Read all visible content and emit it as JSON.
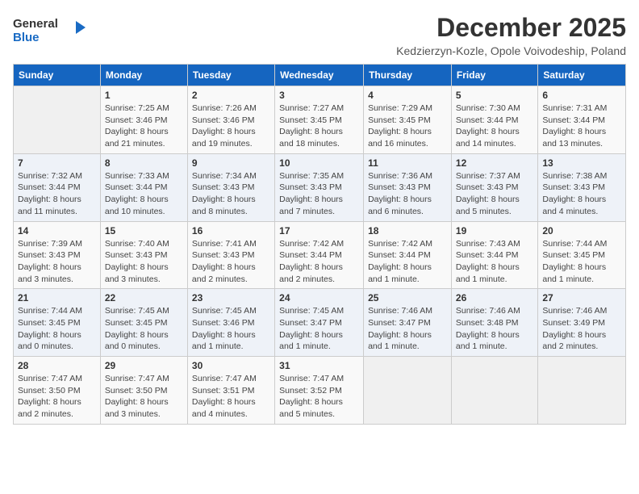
{
  "logo": {
    "line1": "General",
    "line2": "Blue"
  },
  "title": "December 2025",
  "location": "Kedzierzyn-Kozle, Opole Voivodeship, Poland",
  "days_header": [
    "Sunday",
    "Monday",
    "Tuesday",
    "Wednesday",
    "Thursday",
    "Friday",
    "Saturday"
  ],
  "weeks": [
    [
      {
        "day": "",
        "text": ""
      },
      {
        "day": "1",
        "text": "Sunrise: 7:25 AM\nSunset: 3:46 PM\nDaylight: 8 hours\nand 21 minutes."
      },
      {
        "day": "2",
        "text": "Sunrise: 7:26 AM\nSunset: 3:46 PM\nDaylight: 8 hours\nand 19 minutes."
      },
      {
        "day": "3",
        "text": "Sunrise: 7:27 AM\nSunset: 3:45 PM\nDaylight: 8 hours\nand 18 minutes."
      },
      {
        "day": "4",
        "text": "Sunrise: 7:29 AM\nSunset: 3:45 PM\nDaylight: 8 hours\nand 16 minutes."
      },
      {
        "day": "5",
        "text": "Sunrise: 7:30 AM\nSunset: 3:44 PM\nDaylight: 8 hours\nand 14 minutes."
      },
      {
        "day": "6",
        "text": "Sunrise: 7:31 AM\nSunset: 3:44 PM\nDaylight: 8 hours\nand 13 minutes."
      }
    ],
    [
      {
        "day": "7",
        "text": "Sunrise: 7:32 AM\nSunset: 3:44 PM\nDaylight: 8 hours\nand 11 minutes."
      },
      {
        "day": "8",
        "text": "Sunrise: 7:33 AM\nSunset: 3:44 PM\nDaylight: 8 hours\nand 10 minutes."
      },
      {
        "day": "9",
        "text": "Sunrise: 7:34 AM\nSunset: 3:43 PM\nDaylight: 8 hours\nand 8 minutes."
      },
      {
        "day": "10",
        "text": "Sunrise: 7:35 AM\nSunset: 3:43 PM\nDaylight: 8 hours\nand 7 minutes."
      },
      {
        "day": "11",
        "text": "Sunrise: 7:36 AM\nSunset: 3:43 PM\nDaylight: 8 hours\nand 6 minutes."
      },
      {
        "day": "12",
        "text": "Sunrise: 7:37 AM\nSunset: 3:43 PM\nDaylight: 8 hours\nand 5 minutes."
      },
      {
        "day": "13",
        "text": "Sunrise: 7:38 AM\nSunset: 3:43 PM\nDaylight: 8 hours\nand 4 minutes."
      }
    ],
    [
      {
        "day": "14",
        "text": "Sunrise: 7:39 AM\nSunset: 3:43 PM\nDaylight: 8 hours\nand 3 minutes."
      },
      {
        "day": "15",
        "text": "Sunrise: 7:40 AM\nSunset: 3:43 PM\nDaylight: 8 hours\nand 3 minutes."
      },
      {
        "day": "16",
        "text": "Sunrise: 7:41 AM\nSunset: 3:43 PM\nDaylight: 8 hours\nand 2 minutes."
      },
      {
        "day": "17",
        "text": "Sunrise: 7:42 AM\nSunset: 3:44 PM\nDaylight: 8 hours\nand 2 minutes."
      },
      {
        "day": "18",
        "text": "Sunrise: 7:42 AM\nSunset: 3:44 PM\nDaylight: 8 hours\nand 1 minute."
      },
      {
        "day": "19",
        "text": "Sunrise: 7:43 AM\nSunset: 3:44 PM\nDaylight: 8 hours\nand 1 minute."
      },
      {
        "day": "20",
        "text": "Sunrise: 7:44 AM\nSunset: 3:45 PM\nDaylight: 8 hours\nand 1 minute."
      }
    ],
    [
      {
        "day": "21",
        "text": "Sunrise: 7:44 AM\nSunset: 3:45 PM\nDaylight: 8 hours\nand 0 minutes."
      },
      {
        "day": "22",
        "text": "Sunrise: 7:45 AM\nSunset: 3:45 PM\nDaylight: 8 hours\nand 0 minutes."
      },
      {
        "day": "23",
        "text": "Sunrise: 7:45 AM\nSunset: 3:46 PM\nDaylight: 8 hours\nand 1 minute."
      },
      {
        "day": "24",
        "text": "Sunrise: 7:45 AM\nSunset: 3:47 PM\nDaylight: 8 hours\nand 1 minute."
      },
      {
        "day": "25",
        "text": "Sunrise: 7:46 AM\nSunset: 3:47 PM\nDaylight: 8 hours\nand 1 minute."
      },
      {
        "day": "26",
        "text": "Sunrise: 7:46 AM\nSunset: 3:48 PM\nDaylight: 8 hours\nand 1 minute."
      },
      {
        "day": "27",
        "text": "Sunrise: 7:46 AM\nSunset: 3:49 PM\nDaylight: 8 hours\nand 2 minutes."
      }
    ],
    [
      {
        "day": "28",
        "text": "Sunrise: 7:47 AM\nSunset: 3:50 PM\nDaylight: 8 hours\nand 2 minutes."
      },
      {
        "day": "29",
        "text": "Sunrise: 7:47 AM\nSunset: 3:50 PM\nDaylight: 8 hours\nand 3 minutes."
      },
      {
        "day": "30",
        "text": "Sunrise: 7:47 AM\nSunset: 3:51 PM\nDaylight: 8 hours\nand 4 minutes."
      },
      {
        "day": "31",
        "text": "Sunrise: 7:47 AM\nSunset: 3:52 PM\nDaylight: 8 hours\nand 5 minutes."
      },
      {
        "day": "",
        "text": ""
      },
      {
        "day": "",
        "text": ""
      },
      {
        "day": "",
        "text": ""
      }
    ]
  ]
}
